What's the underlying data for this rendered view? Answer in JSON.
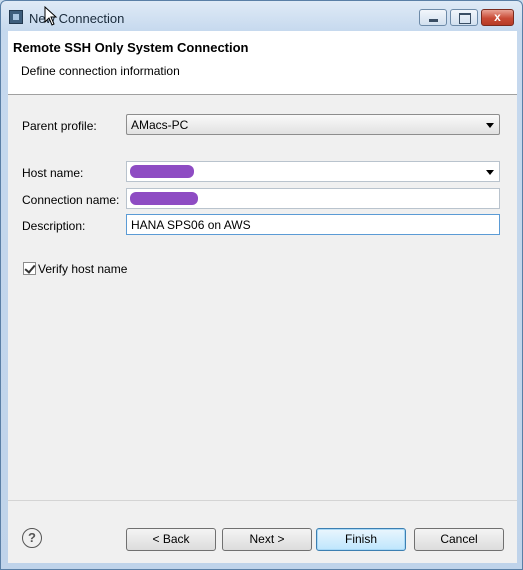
{
  "window": {
    "title": "New Connection",
    "icons": {
      "app": "eclipse-window-icon",
      "minimize": "minimize-icon",
      "maximize": "maximize-icon",
      "close": "close-icon"
    },
    "close_symbol": "x"
  },
  "header": {
    "title": "Remote SSH Only System Connection",
    "subtitle": "Define connection information"
  },
  "form": {
    "parent_profile_label": "Parent profile:",
    "parent_profile_value": "AMacs-PC",
    "host_name_label": "Host name:",
    "host_name_value": "",
    "connection_name_label": "Connection name:",
    "connection_name_value": "",
    "description_label": "Description:",
    "description_value": "HANA SPS06 on AWS",
    "verify_label": "Verify host name",
    "verify_checked": true
  },
  "footer": {
    "help_symbol": "?",
    "back": "< Back",
    "next": "Next >",
    "finish": "Finish",
    "cancel": "Cancel"
  },
  "colors": {
    "redaction": "#7a2db8",
    "focus_border": "#5b9bd5"
  }
}
